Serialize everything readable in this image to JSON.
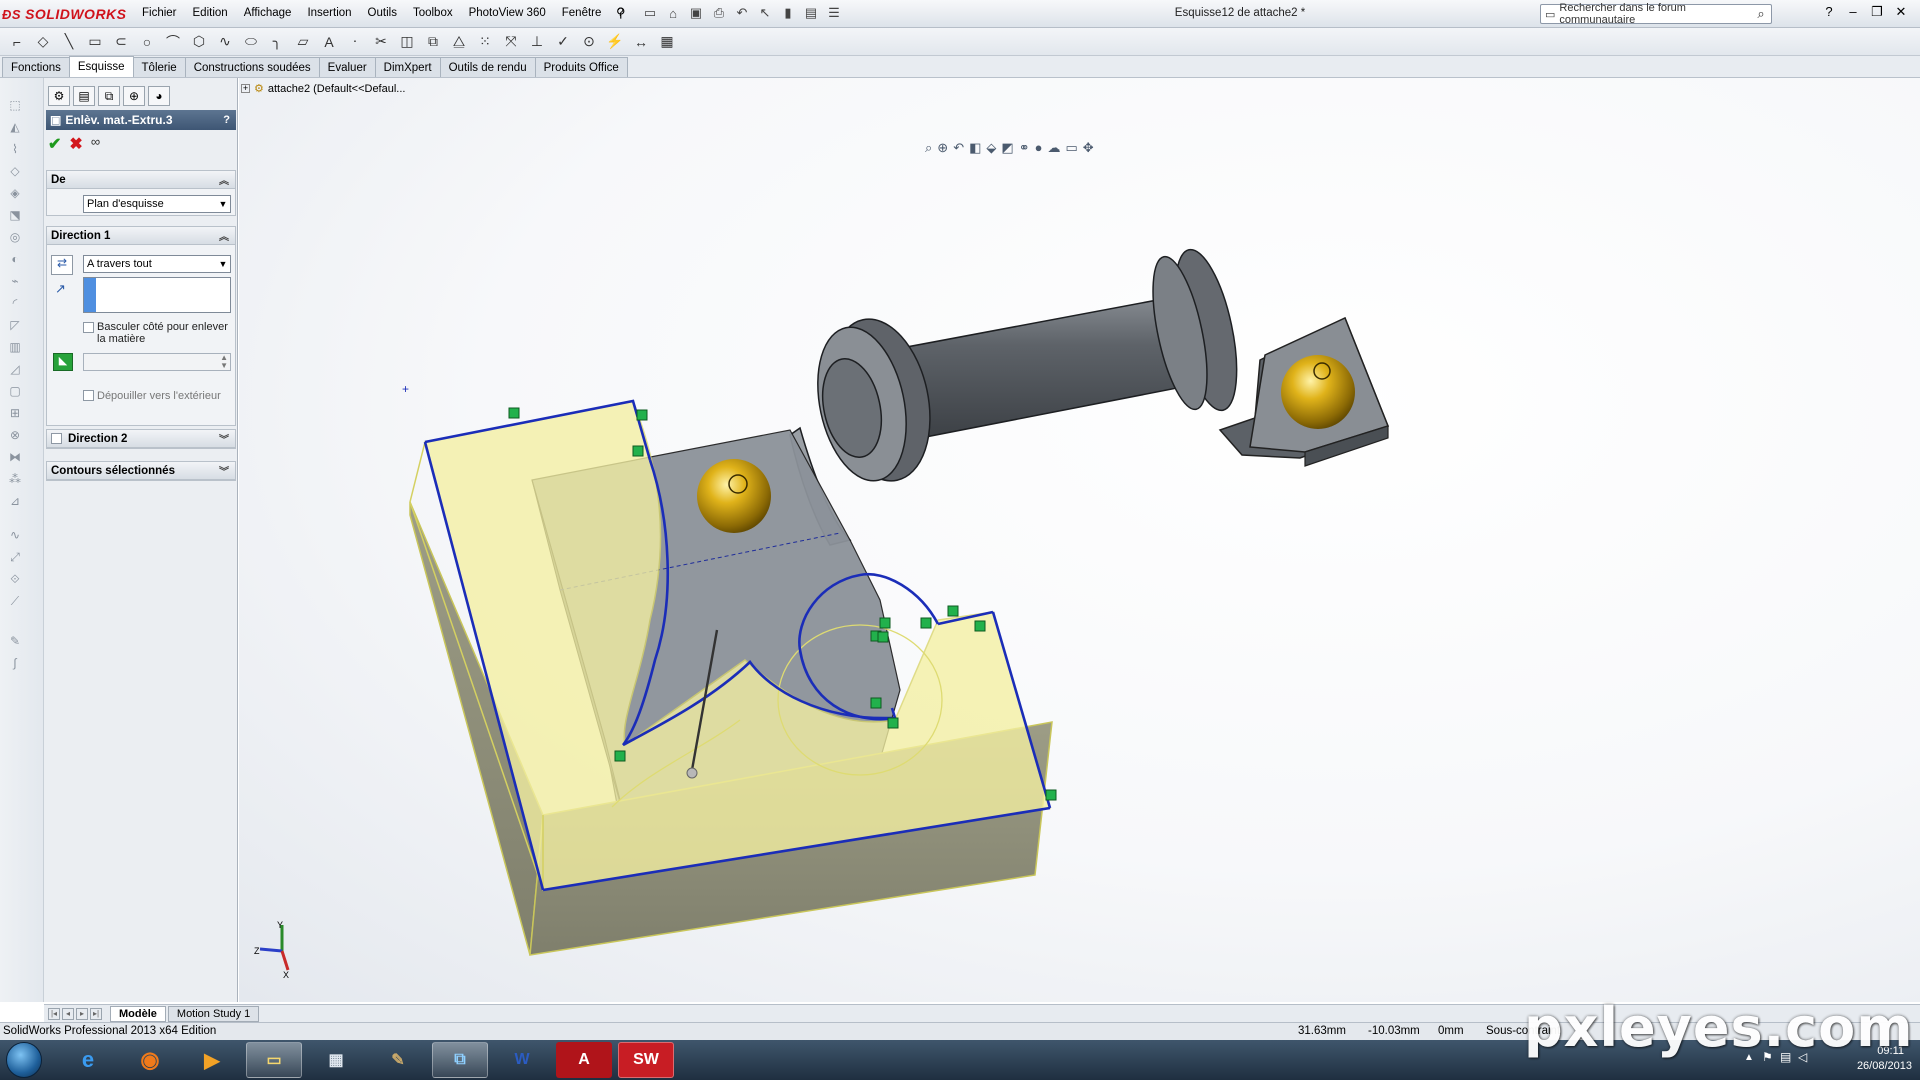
{
  "app": {
    "logo_text": "SOLIDWORKS",
    "document_title": "Esquisse12 de attache2 *"
  },
  "menu": [
    "Fichier",
    "Edition",
    "Affichage",
    "Insertion",
    "Outils",
    "Toolbox",
    "PhotoView 360",
    "Fenêtre",
    "?"
  ],
  "search": {
    "placeholder": "Rechercher dans le forum communautaire"
  },
  "command_tabs": [
    "Fonctions",
    "Esquisse",
    "Tôlerie",
    "Constructions soudées",
    "Evaluer",
    "DimXpert",
    "Outils de rendu",
    "Produits Office"
  ],
  "active_tab": "Esquisse",
  "property_manager": {
    "title": "Enlèv. mat.-Extru.3",
    "help": "?",
    "from": {
      "heading": "De",
      "value": "Plan d'esquisse"
    },
    "direction1": {
      "heading": "Direction 1",
      "end_condition": "A travers tout",
      "flip_side_label": "Basculer côté pour enlever la matière",
      "draft_outward_label": "Dépouiller vers l'extérieur"
    },
    "direction2": {
      "heading": "Direction 2"
    },
    "selected_contours": {
      "heading": "Contours sélectionnés"
    }
  },
  "feature_tree": {
    "root": "attache2  (Default<<Defaul..."
  },
  "triad": {
    "x": "X",
    "y": "Y",
    "z": "Z"
  },
  "bottom_tabs": [
    "Modèle",
    "Motion Study 1"
  ],
  "status": {
    "edition": "SolidWorks Professional 2013 x64 Edition",
    "x": "31.63mm",
    "y": "-10.03mm",
    "z": "0mm",
    "state": "Sous-contraint"
  },
  "taskbar": {
    "time": "09:11",
    "date": "26/08/2013"
  },
  "watermark": "pxleyes.com",
  "colors": {
    "sketch_line": "#1b2db8",
    "face_yellow": "#f2f0a0",
    "relation_green": "#22b14c",
    "pm_header": "#4b6482"
  }
}
